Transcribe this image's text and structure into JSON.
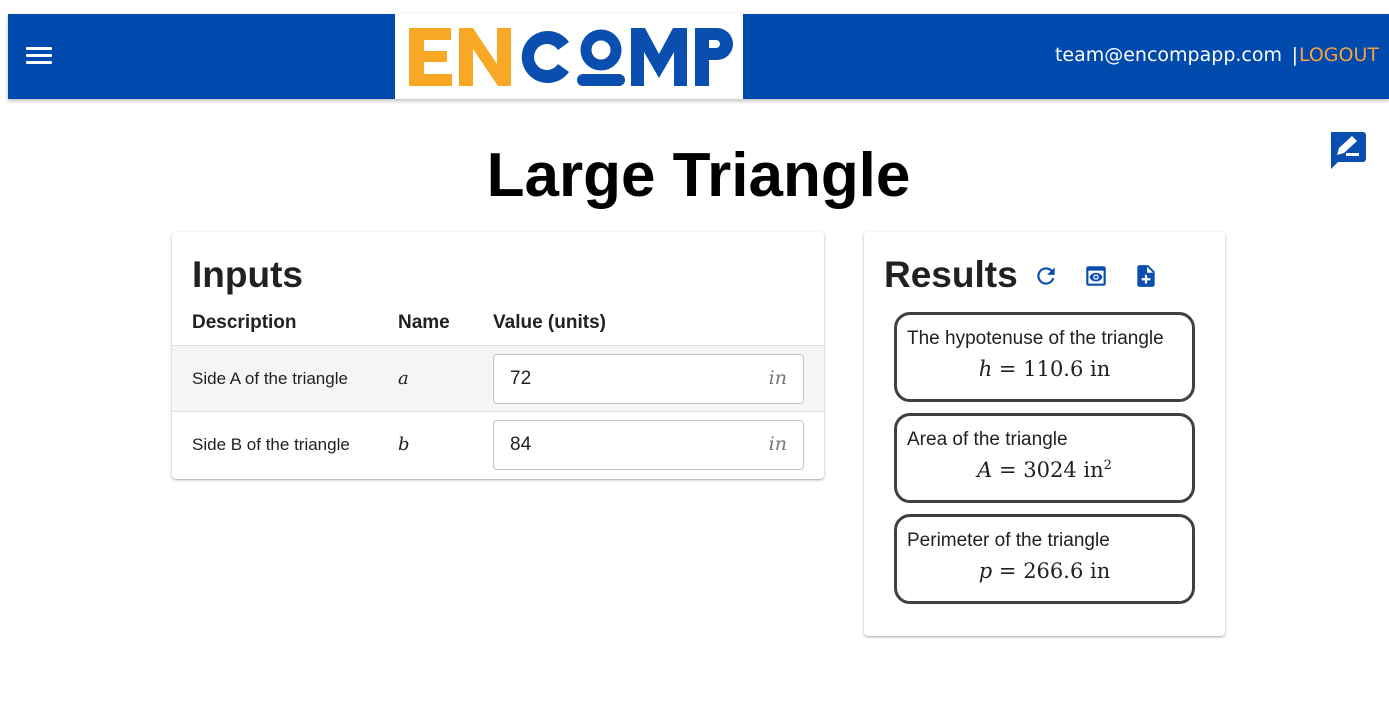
{
  "header": {
    "logo_text": "ENCOMP",
    "user_email": "team@encompapp.com",
    "separator": "|",
    "logout_label": "LOGOUT",
    "colors": {
      "bar": "#004aad",
      "accent": "#f9a03f",
      "logo_orange": "#f9a825",
      "logo_blue": "#0a4fb0"
    }
  },
  "page": {
    "title": "Large Triangle"
  },
  "inputs": {
    "title": "Inputs",
    "columns": [
      "Description",
      "Name",
      "Value (units)"
    ],
    "rows": [
      {
        "description": "Side A of the triangle",
        "name": "a",
        "value": "72",
        "unit": "in"
      },
      {
        "description": "Side B of the triangle",
        "name": "b",
        "value": "84",
        "unit": "in"
      }
    ]
  },
  "results": {
    "title": "Results",
    "icons": [
      "refresh-icon",
      "preview-icon",
      "add-report-icon"
    ],
    "items": [
      {
        "label": "The hypotenuse of the triangle",
        "var": "h",
        "eq": "=",
        "value": "110.6",
        "unit": "in",
        "exp": ""
      },
      {
        "label": "Area of the triangle",
        "var": "A",
        "eq": "=",
        "value": "3024",
        "unit": "in",
        "exp": "2"
      },
      {
        "label": "Perimeter of the triangle",
        "var": "p",
        "eq": "=",
        "value": "266.6",
        "unit": "in",
        "exp": ""
      }
    ]
  }
}
